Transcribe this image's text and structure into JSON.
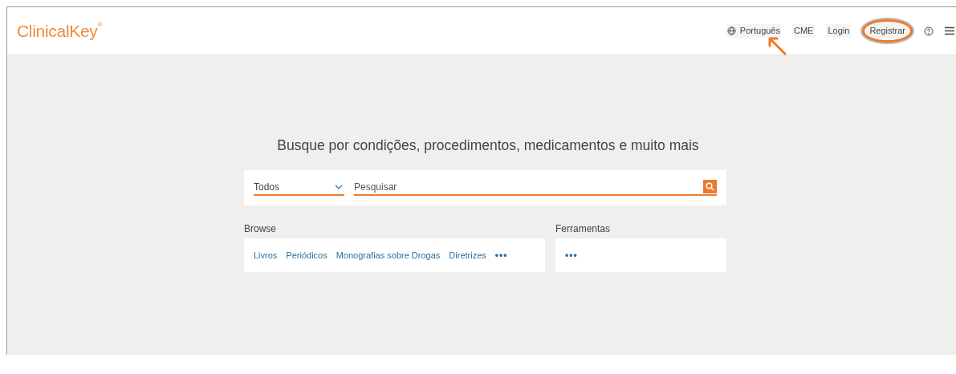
{
  "header": {
    "logo": "ClinicalKey",
    "logo_mark": "®",
    "nav": [
      {
        "kind": "language",
        "label": "Português",
        "arrow": true
      },
      {
        "kind": "link",
        "label": "CME",
        "highlighted": false
      },
      {
        "kind": "link",
        "label": "Login",
        "highlighted": false
      },
      {
        "kind": "link",
        "label": "Registrar",
        "highlighted": true
      },
      {
        "kind": "help"
      },
      {
        "kind": "menu"
      }
    ]
  },
  "search": {
    "heading": "Busque por condições, procedimentos, medicamentos e muito mais",
    "scope": "Todos",
    "placeholder": "Pesquisar"
  },
  "browse": {
    "title": "Browse",
    "links": [
      "Livros",
      "Periódicos",
      "Monografias sobre Drogas",
      "Diretrizes"
    ],
    "more": "•••"
  },
  "tools": {
    "title": "Ferramentas",
    "more": "•••"
  }
}
